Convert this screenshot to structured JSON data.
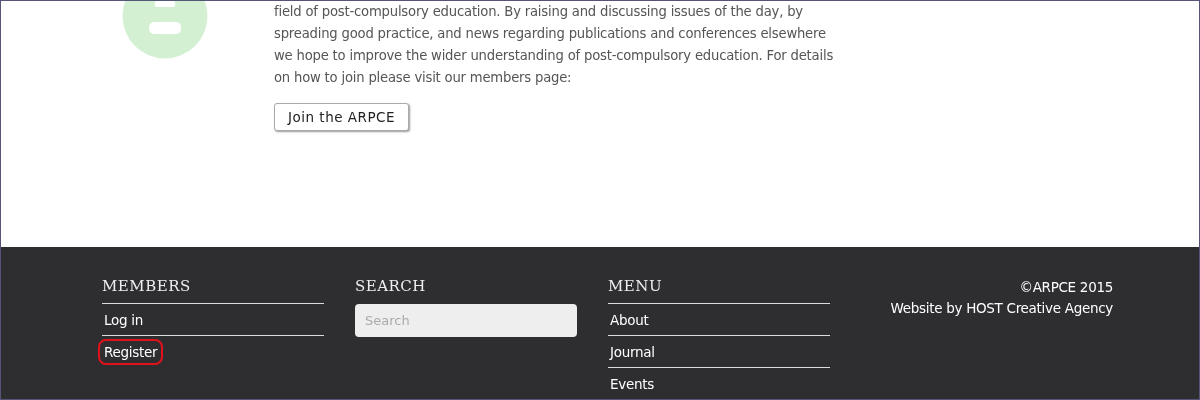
{
  "intro": {
    "paragraph": "field of post-compulsory education. By raising and discussing issues of the day, by spreading good practice, and news regarding publications and conferences elsewhere we hope to improve the wider understanding of post-compulsory education. For details on how to join please visit our members page:",
    "button": "Join the ARPCE"
  },
  "footer": {
    "members": {
      "heading": "MEMBERS",
      "links": [
        {
          "label": "Log in",
          "highlighted": false
        },
        {
          "label": "Register",
          "highlighted": true
        }
      ]
    },
    "search": {
      "heading": "SEARCH",
      "placeholder": "Search"
    },
    "menu": {
      "heading": "MENU",
      "links": [
        {
          "label": "About",
          "highlighted": false
        },
        {
          "label": "Journal",
          "highlighted": false
        },
        {
          "label": "Events",
          "highlighted": false
        }
      ]
    },
    "copyright": "©ARPCE 2015",
    "credit": "Website by HOST Creative Agency"
  }
}
